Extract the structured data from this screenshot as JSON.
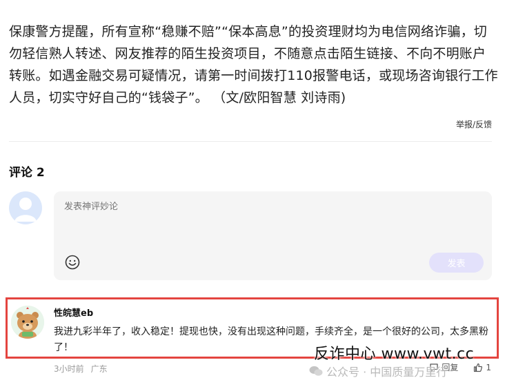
{
  "article": {
    "paragraph": "保康警方提醒，所有宣称“稳赚不赔”“保本高息”的投资理财均为电信网络诈骗，切勿轻信熟人转述、网友推荐的陌生投资项目，不随意点击陌生链接、不向不明账户转账。如遇金融交易可疑情况，请第一时间拨打110报警电话，或现场咨询银行工作人员，切实守好自己的“钱袋子”。 （文/欧阳智慧 刘诗雨)"
  },
  "report_link": "举报/反馈",
  "comments": {
    "title": "评论 2",
    "compose": {
      "placeholder": "发表神评妙论",
      "send_label": "发表"
    },
    "items": [
      {
        "user": "性皖慧eb",
        "text": "我进九彩半年了，收入稳定！提现也快，没有出现这种问题，手续齐全，是一个很好的公司，太多黑粉了！",
        "time": "3小时前",
        "location": "广东",
        "reply_label": "回复",
        "like_count": "1"
      }
    ]
  },
  "watermark": {
    "line1": "反诈中心  www.vwt.cc",
    "line2": "公众号 · 中国质量万里行"
  },
  "colors": {
    "highlight_border": "#e4443f",
    "send_button_bg": "#e3e1fb",
    "muted_text": "#9a9a9a"
  }
}
